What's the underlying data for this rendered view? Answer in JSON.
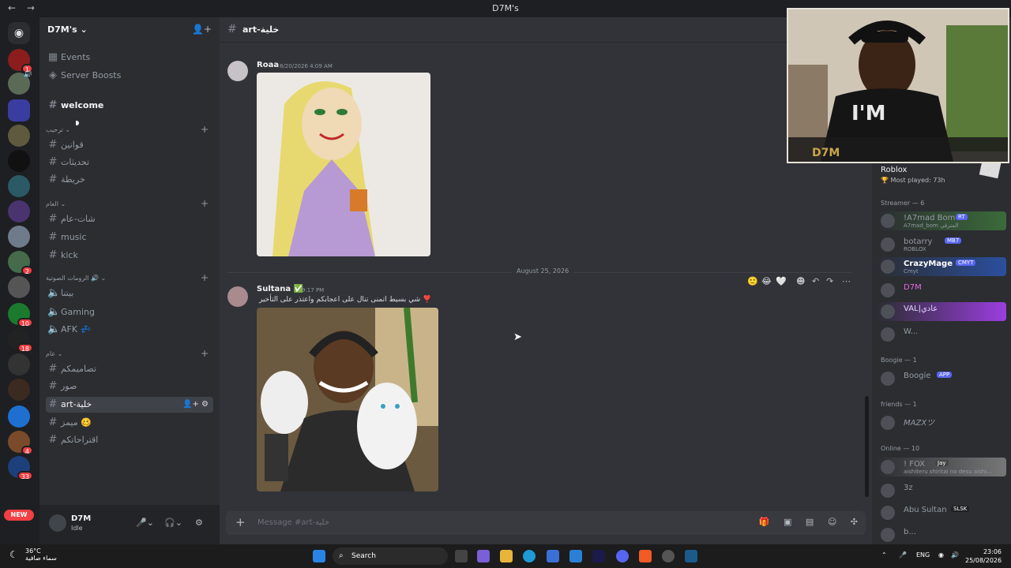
{
  "window": {
    "title": "D7M's",
    "back": "←",
    "forward": "→"
  },
  "guild": {
    "name": "D7M's ⌄"
  },
  "sidebar_top": [
    {
      "label": "Events"
    },
    {
      "label": "Server Boosts"
    }
  ],
  "channels": {
    "welcome": "welcome",
    "cat1": "ترحيب ⌄",
    "rules": "قوانين",
    "updates": "تحديثات",
    "map": "خريطة",
    "cat2": "العام ⌄",
    "general_chat": "شات-عام",
    "music": "music",
    "kick": "kick",
    "cat3": "الرومات الصوتية 🔊 ⌄",
    "voice1": "بيتنا",
    "gaming": "Gaming",
    "afk": "AFK 💤",
    "cat4": "عام ⌄",
    "designs": "تصاميمكم",
    "pics": "صور",
    "art": "art-خلية",
    "memes": "ميمز 🥴",
    "suggestions": "اقتراحاتكم"
  },
  "user_panel": {
    "name": "D7M",
    "status": "Idle"
  },
  "chat": {
    "channel_name": "art-خلية",
    "date_divider": "August 25, 2026",
    "messages": [
      {
        "author": "Roaa",
        "time": "8/20/2026 4:09 AM",
        "text": ""
      },
      {
        "author": "Sultana ✅",
        "time": "9:17 PM",
        "text": "شي بسيط اتمنى تنال على اعجابكم واعتذر على التأخير ❣️"
      }
    ],
    "composer_placeholder": "Message #art-خلية",
    "new_badge": "NEW"
  },
  "members": {
    "activity_user": "botarry",
    "activity_game": "Roblox",
    "activity_played": "🏆 Most played: 73h",
    "sections": [
      {
        "title": "Streamer — 6"
      },
      {
        "title": "Boogie — 1"
      },
      {
        "title": "friends — 1"
      },
      {
        "title": "Online — 10"
      }
    ],
    "list": [
      {
        "name": "!A7mad Bom",
        "tag": "RT",
        "sub": "A7mad_bom المترقي"
      },
      {
        "name": "botarry",
        "tag": "MB7",
        "sub": "ROBLOX"
      },
      {
        "name": "CrazyMage",
        "tag": "CMYT",
        "sub": "Cmyt"
      },
      {
        "name": "D7M",
        "tag": "",
        "sub": ""
      },
      {
        "name": "VAL|عادي",
        "tag": "",
        "sub": ""
      },
      {
        "name": "W...",
        "tag": "",
        "sub": ""
      },
      {
        "name": "Boogie",
        "tag": "APP",
        "sub": ""
      },
      {
        "name": "MAZXツ",
        "tag": "",
        "sub": ""
      },
      {
        "name": "! FOX",
        "tag": "Jay",
        "sub": "aishiteru shiritai no desu aishi..."
      },
      {
        "name": "3z",
        "tag": "",
        "sub": ""
      },
      {
        "name": "Abu Sultan",
        "tag": "SLSK",
        "sub": ""
      },
      {
        "name": "b...",
        "tag": "",
        "sub": ""
      }
    ]
  },
  "server_badges": [
    "1",
    "2",
    "10",
    "18",
    "4",
    "33"
  ],
  "taskbar": {
    "temp": "36°C",
    "weather": "سماء صافية",
    "search": "Search",
    "lang": "ENG",
    "time": "23:06",
    "date": "25/08/2026"
  },
  "colors": {
    "accent": "#5865f2",
    "danger": "#f23f43",
    "online": "#23a55a"
  }
}
